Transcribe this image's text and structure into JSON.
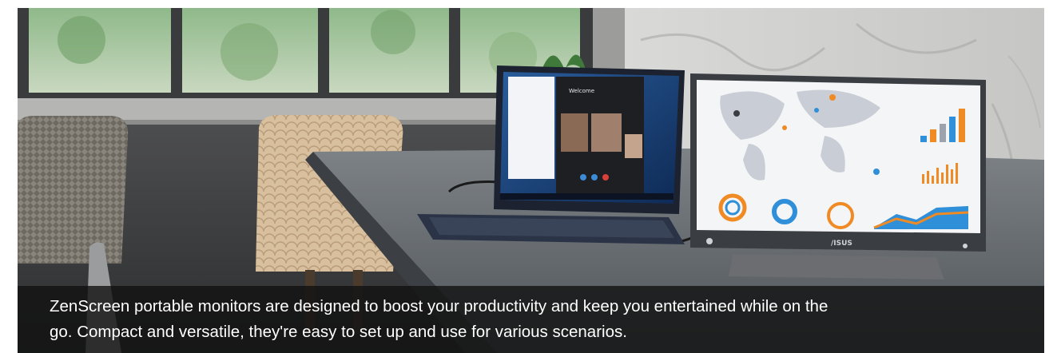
{
  "hero": {
    "caption_line1": "ZenScreen portable monitors are designed to boost your productivity and keep you entertained while on the",
    "caption_line2": "go. Compact and versatile, they're easy to set up and use for various scenarios.",
    "laptop_app_title": "Welcome",
    "monitor_brand": "/ISUS"
  },
  "colors": {
    "caption_bg": "#121212",
    "caption_text": "#ffffff",
    "accent_orange": "#f08a24",
    "accent_blue": "#2f8fd8"
  }
}
